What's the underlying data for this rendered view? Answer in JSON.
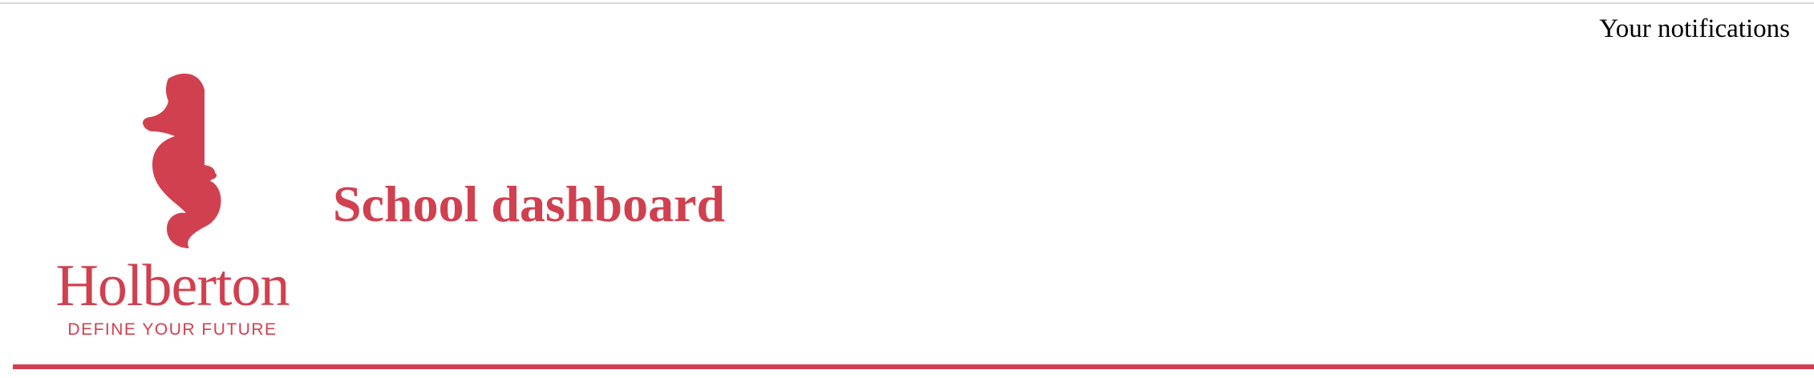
{
  "header": {
    "notifications_label": "Your notifications",
    "title": "School dashboard",
    "logo": {
      "wordmark": "Holberton",
      "tagline": "DEFINE YOUR FUTURE",
      "icon": "seahorse-icon"
    }
  },
  "colors": {
    "brand": "#d1404f",
    "text": "#000000",
    "background": "#ffffff",
    "top_rule": "#d7d7d7"
  }
}
